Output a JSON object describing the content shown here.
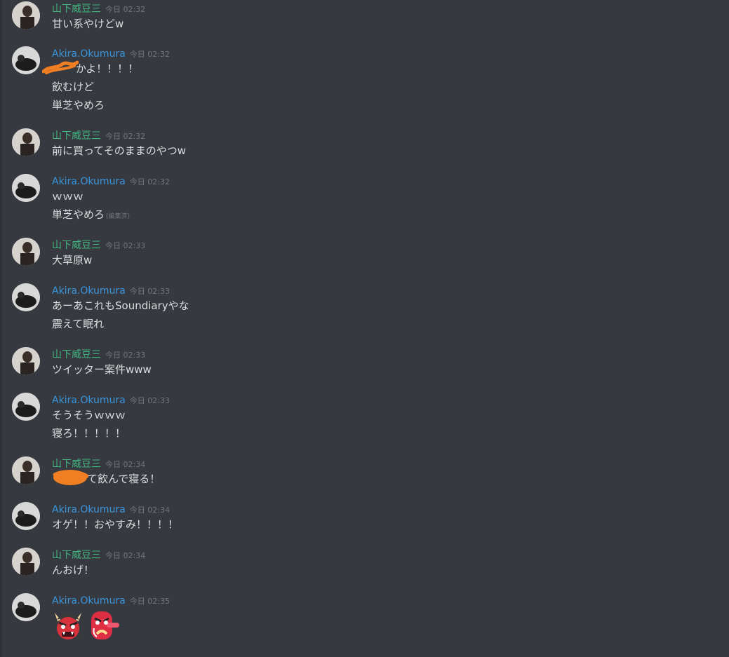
{
  "colors": {
    "background": "#36393f",
    "user_green": "#43b581",
    "user_blue": "#3b95db",
    "text": "#dcddde",
    "timestamp": "#72767d",
    "scribble": "#f07e22"
  },
  "users": {
    "yamashita": "山下威豆三",
    "akira": "Akira.Okumura"
  },
  "messages": [
    {
      "author": "山下威豆三",
      "time": "今日 02:32",
      "lines": [
        "甘い系やけどw"
      ]
    },
    {
      "author": "Akira.Okumura",
      "time": "今日 02:32",
      "lines": [
        "かよ！！！！",
        "飲むけど",
        "単芝やめろ"
      ]
    },
    {
      "author": "山下威豆三",
      "time": "今日 02:32",
      "lines": [
        "前に買ってそのままのやつw"
      ]
    },
    {
      "author": "Akira.Okumura",
      "time": "今日 02:32",
      "lines": [
        "ｗｗｗ",
        "単芝やめろ"
      ],
      "edited": "(編集済)"
    },
    {
      "author": "山下威豆三",
      "time": "今日 02:33",
      "lines": [
        "大草原w"
      ]
    },
    {
      "author": "Akira.Okumura",
      "time": "今日 02:33",
      "lines": [
        "あーあこれもSoundiaryやな",
        "震えて眠れ"
      ]
    },
    {
      "author": "山下威豆三",
      "time": "今日 02:33",
      "lines": [
        "ツイッター案件www"
      ]
    },
    {
      "author": "Akira.Okumura",
      "time": "今日 02:33",
      "lines": [
        "そうそうｗｗｗ",
        "寝ろ！！！！！"
      ]
    },
    {
      "author": "山下威豆三",
      "time": "今日 02:34",
      "lines": [
        "て飲んで寝る！"
      ]
    },
    {
      "author": "Akira.Okumura",
      "time": "今日 02:34",
      "lines": [
        "オゲ！！おやすみ！！！！"
      ]
    },
    {
      "author": "山下威豆三",
      "time": "今日 02:34",
      "lines": [
        "んおげ！"
      ]
    },
    {
      "author": "Akira.Okumura",
      "time": "今日 02:35",
      "lines": [],
      "emojis": [
        "japanese-ogre",
        "japanese-goblin"
      ]
    }
  ]
}
